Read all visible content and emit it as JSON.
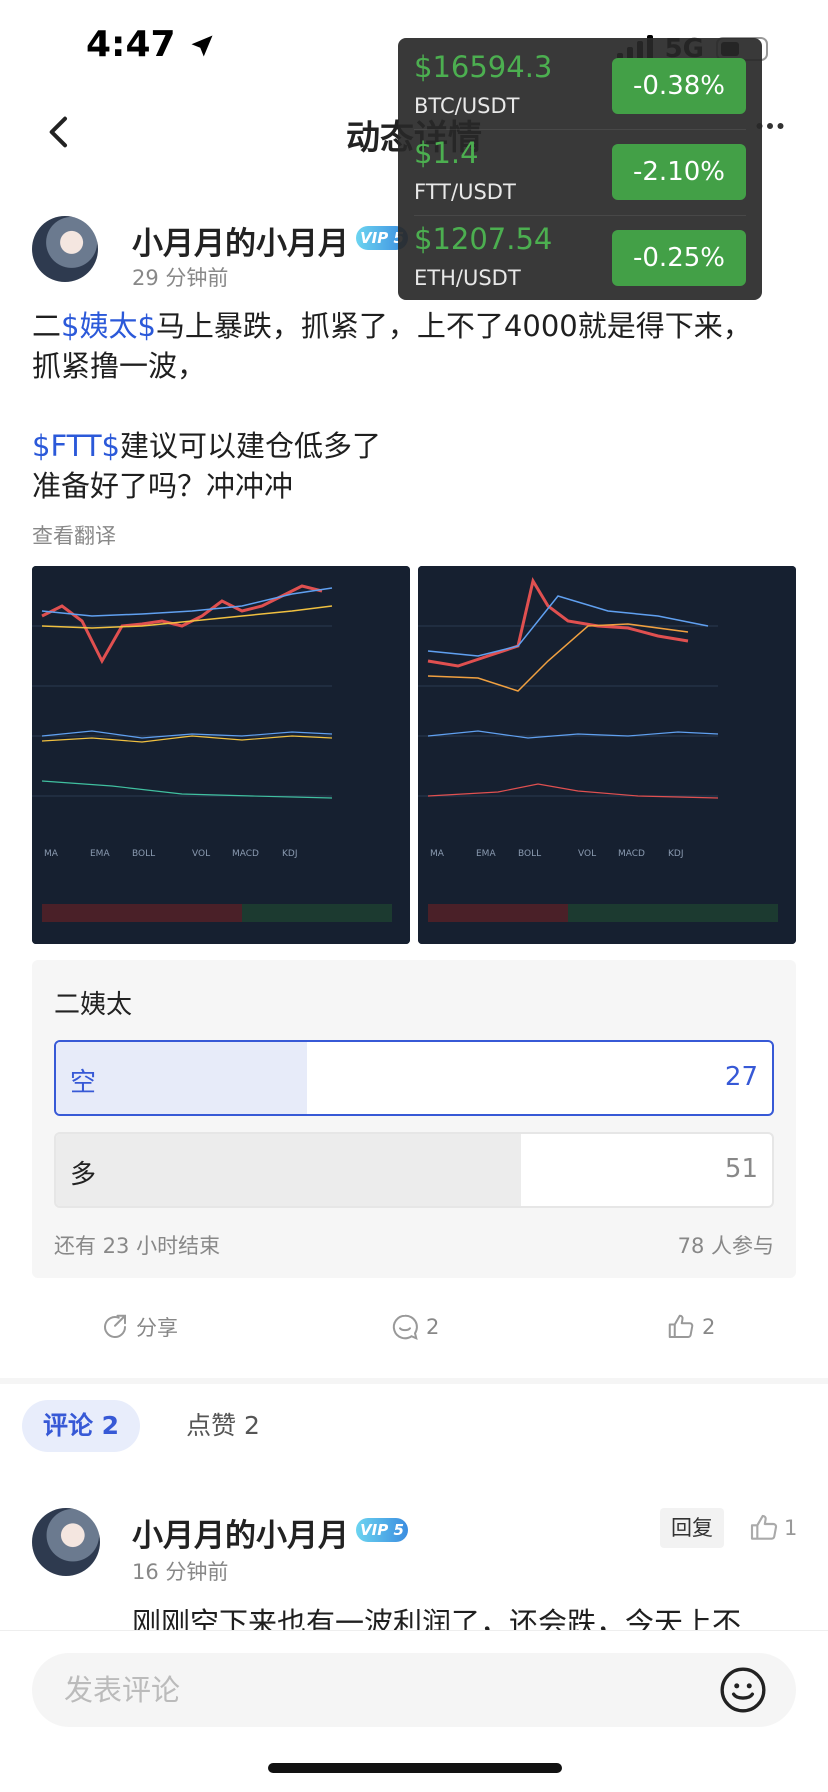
{
  "status_bar": {
    "time": "4:47",
    "network": "5G"
  },
  "header": {
    "title": "动态详情",
    "back_icon": "chevron-left-icon",
    "more_icon": "more-dots-icon"
  },
  "ticker": [
    {
      "price": "$16594.3",
      "pair": "BTC/USDT",
      "change": "-0.38%"
    },
    {
      "price": "$1.4",
      "pair": "FTT/USDT",
      "change": "-2.10%"
    },
    {
      "price": "$1207.54",
      "pair": "ETH/USDT",
      "change": "-0.25%"
    }
  ],
  "post": {
    "username": "小月月的小月月",
    "vip": "VIP 5",
    "time": "29 分钟前",
    "line1_pre": "二",
    "line1_tag": "$姨太$",
    "line1_post": "马上暴跌，抓紧了，上不了4000就是得下来，抓紧撸一波，",
    "line2_tag": "$FTT$",
    "line2_post": "建议可以建仓低多了",
    "line3": "准备好了吗？冲冲冲",
    "translate": "查看翻译"
  },
  "poll": {
    "title": "二姨太",
    "options": [
      {
        "label": "空",
        "count": "27",
        "share": 0.35
      },
      {
        "label": "多",
        "count": "51",
        "share": 0.65
      }
    ],
    "remaining": "还有 23 小时结束",
    "participants": "78 人参与"
  },
  "actions": {
    "share_label": "分享",
    "comment_count": "2",
    "like_count": "2"
  },
  "tabs": {
    "comments": "评论 2",
    "likes": "点赞 2"
  },
  "comment": {
    "username": "小月月的小月月",
    "vip": "VIP 5",
    "time": "16 分钟前",
    "reply": "回复",
    "like_count": "1",
    "text": "刚刚空下来也有一波利润了，还会跌，今天上不"
  },
  "bottom": {
    "input_placeholder": "发表评论"
  },
  "colors": {
    "up": "#43a047",
    "link": "#2b59d9",
    "poll_accent": "#3759d6"
  }
}
